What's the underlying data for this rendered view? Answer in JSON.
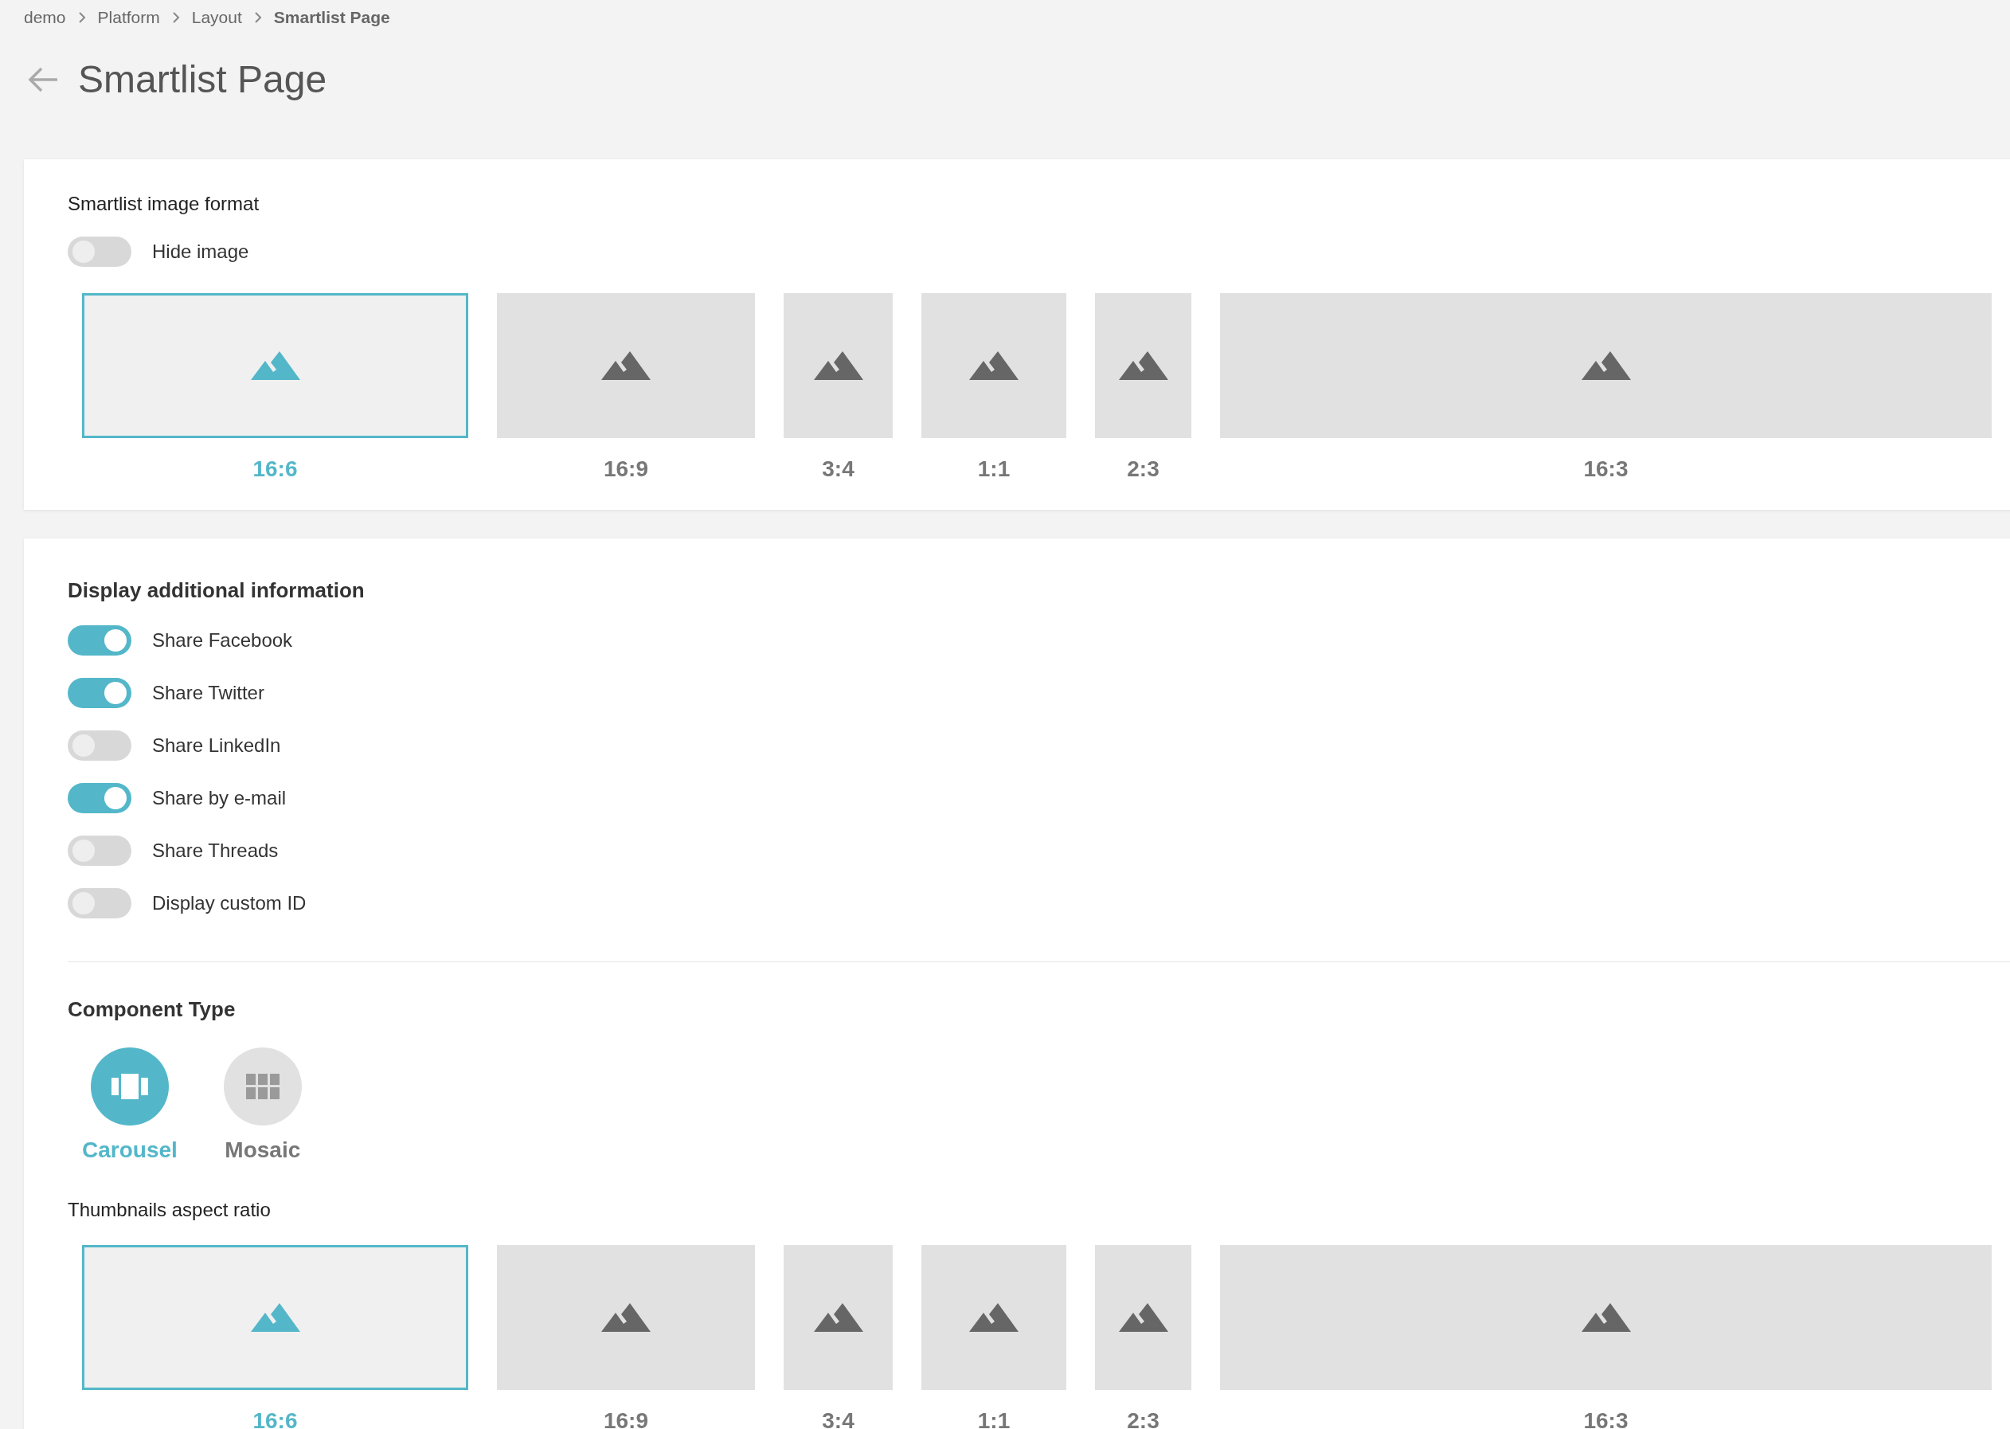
{
  "breadcrumb": [
    {
      "label": "demo",
      "current": false
    },
    {
      "label": "Platform",
      "current": false
    },
    {
      "label": "Layout",
      "current": false
    },
    {
      "label": "Smartlist Page",
      "current": true
    }
  ],
  "page_title": "Smartlist Page",
  "image_format": {
    "title": "Smartlist image format",
    "hide_image": {
      "label": "Hide image",
      "on": false
    },
    "formats": [
      {
        "label": "16:6",
        "selected": true
      },
      {
        "label": "16:9",
        "selected": false
      },
      {
        "label": "3:4",
        "selected": false
      },
      {
        "label": "1:1",
        "selected": false
      },
      {
        "label": "2:3",
        "selected": false
      },
      {
        "label": "16:3",
        "selected": false
      }
    ]
  },
  "additional_info": {
    "title": "Display additional information",
    "options": [
      {
        "label": "Share Facebook",
        "on": true
      },
      {
        "label": "Share Twitter",
        "on": true
      },
      {
        "label": "Share LinkedIn",
        "on": false
      },
      {
        "label": "Share by e-mail",
        "on": true
      },
      {
        "label": "Share Threads",
        "on": false
      },
      {
        "label": "Display custom ID",
        "on": false
      }
    ]
  },
  "component_type": {
    "title": "Component Type",
    "types": [
      {
        "kind": "carousel",
        "label": "Carousel",
        "selected": true
      },
      {
        "kind": "mosaic",
        "label": "Mosaic",
        "selected": false
      }
    ]
  },
  "thumbnails": {
    "title": "Thumbnails aspect ratio",
    "formats": [
      {
        "label": "16:6",
        "selected": true
      },
      {
        "label": "16:9",
        "selected": false
      },
      {
        "label": "3:4",
        "selected": false
      },
      {
        "label": "1:1",
        "selected": false
      },
      {
        "label": "2:3",
        "selected": false
      },
      {
        "label": "16:3",
        "selected": false
      }
    ]
  }
}
